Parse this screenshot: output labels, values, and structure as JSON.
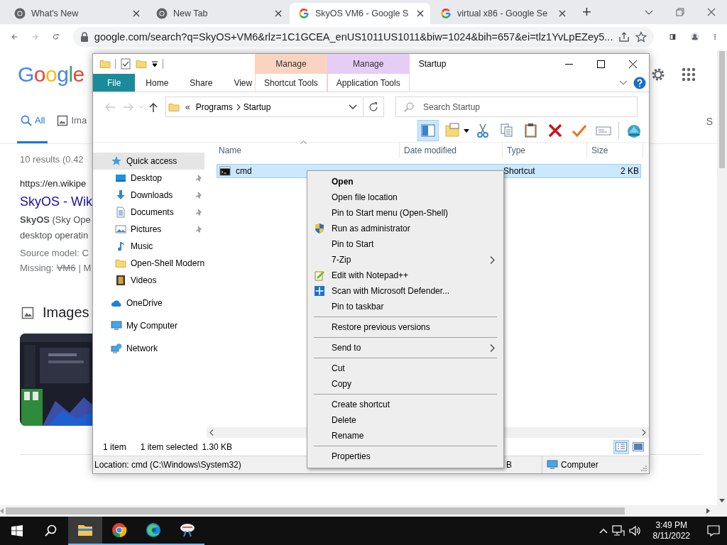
{
  "browser": {
    "tabs": [
      {
        "title": "What's New",
        "kind": "chrome",
        "selected": false
      },
      {
        "title": "New Tab",
        "kind": "chrome",
        "selected": false
      },
      {
        "title": "SkyOS VM6 - Google S",
        "kind": "google",
        "selected": true
      },
      {
        "title": "virtual x86 - Google Se",
        "kind": "google",
        "selected": false
      }
    ],
    "new_tab": "+",
    "url": "google.com/search?q=SkyOS+VM6&rlz=1C1GCEA_enUS1011US1011&biw=1024&bih=657&ei=tlz1YvLpEZey5..."
  },
  "google": {
    "logo": [
      {
        "letter": "G",
        "color": "#4285f4"
      },
      {
        "letter": "o",
        "color": "#ea4335"
      },
      {
        "letter": "o",
        "color": "#fbbc05"
      },
      {
        "letter": "g",
        "color": "#4285f4"
      },
      {
        "letter": "l",
        "color": "#34a853"
      },
      {
        "letter": "e",
        "color": "#ea4335"
      }
    ],
    "nav": [
      {
        "label": "All",
        "kind": "all",
        "selected": true
      },
      {
        "label": "Ima",
        "kind": "images",
        "selected": false
      }
    ],
    "nav_right": "S",
    "stats": "10 results (0.42",
    "result": {
      "url": "https://en.wikipe",
      "title": "SkyOS - Wik",
      "snippet": [
        "**SkyOS** (Sky Ope",
        "desktop operatin"
      ],
      "source": "Source model: C",
      "missing": {
        "label": "Missing:",
        "term": "VM6",
        "rest": "| M"
      }
    },
    "images_heading": "Images"
  },
  "explorer": {
    "title": "Startup",
    "tabs": [
      {
        "label": "File",
        "kind": "file"
      },
      {
        "label": "Home",
        "kind": "tab"
      },
      {
        "label": "Share",
        "kind": "tab"
      },
      {
        "label": "View",
        "kind": "tab"
      }
    ],
    "context_tabs": [
      {
        "heading": "Manage",
        "label": "Shortcut Tools",
        "color": "#fad4c0"
      },
      {
        "heading": "Manage",
        "label": "Application Tools",
        "color": "#e6cdf6"
      }
    ],
    "address": {
      "overflow": "«",
      "crumbs": [
        "Programs",
        "Startup"
      ]
    },
    "search": {
      "placeholder": "Search Startup"
    },
    "toolbar": [
      {
        "kind": "preview",
        "pressed": true
      },
      {
        "kind": "properties",
        "pressed": false
      },
      {
        "kind": "cut",
        "pressed": false
      },
      {
        "kind": "copy",
        "pressed": false
      },
      {
        "kind": "paste",
        "pressed": false
      },
      {
        "kind": "delete",
        "pressed": false
      },
      {
        "kind": "check",
        "pressed": false
      },
      {
        "kind": "rename",
        "pressed": false
      },
      {
        "kind": "shell",
        "pressed": false
      }
    ],
    "nav": [
      {
        "label": "Quick access",
        "kind": "star",
        "selected": true,
        "children": [
          {
            "label": "Desktop",
            "kind": "desktop",
            "pinned": true,
            "selected": false
          },
          {
            "label": "Downloads",
            "kind": "downloads",
            "pinned": true,
            "selected": false
          },
          {
            "label": "Documents",
            "kind": "documents",
            "pinned": true,
            "selected": false
          },
          {
            "label": "Pictures",
            "kind": "pictures",
            "pinned": true,
            "selected": false
          },
          {
            "label": "Music",
            "kind": "music",
            "pinned": false,
            "selected": false
          },
          {
            "label": "Open-Shell Modern",
            "kind": "folder",
            "pinned": false,
            "selected": false
          },
          {
            "label": "Videos",
            "kind": "videos",
            "pinned": false,
            "selected": false
          }
        ]
      },
      {
        "label": "OneDrive",
        "kind": "cloud",
        "selected": false
      },
      {
        "label": "My Computer",
        "kind": "computer",
        "selected": false
      },
      {
        "label": "Network",
        "kind": "network",
        "selected": false
      }
    ],
    "columns": [
      {
        "label": "Name",
        "sorted": true
      },
      {
        "label": "Date modified",
        "sorted": false
      },
      {
        "label": "Type",
        "sorted": false
      },
      {
        "label": "Size",
        "sorted": false
      }
    ],
    "files": [
      {
        "name": "cmd",
        "type": "Shortcut",
        "size": "2 KB",
        "selected": true
      }
    ],
    "status": {
      "count": "1 item",
      "selection": "1 item selected",
      "size": "1.30 KB"
    },
    "view_buttons": [
      {
        "kind": "details",
        "selected": true
      },
      {
        "kind": "tiles",
        "selected": false
      }
    ],
    "details_bar": {
      "location": "Location: cmd (C:\\Windows\\System32)",
      "size_tail": "B",
      "zone": "Computer"
    }
  },
  "context_menu": {
    "items": [
      {
        "kind": "item",
        "label": "Open",
        "default": true
      },
      {
        "kind": "item",
        "label": "Open file location",
        "default": false
      },
      {
        "kind": "item",
        "label": "Pin to Start menu (Open-Shell)",
        "default": false
      },
      {
        "kind": "admin",
        "label": "Run as administrator",
        "default": false
      },
      {
        "kind": "item",
        "label": "Pin to Start",
        "default": false
      },
      {
        "kind": "submenu",
        "label": "7-Zip",
        "default": false
      },
      {
        "kind": "notepad",
        "label": "Edit with Notepad++",
        "default": false
      },
      {
        "kind": "defender",
        "label": "Scan with Microsoft Defender...",
        "default": false
      },
      {
        "kind": "item",
        "label": "Pin to taskbar",
        "default": false
      },
      {
        "kind": "separator"
      },
      {
        "kind": "item",
        "label": "Restore previous versions",
        "default": false
      },
      {
        "kind": "separator"
      },
      {
        "kind": "submenu",
        "label": "Send to",
        "default": false
      },
      {
        "kind": "separator"
      },
      {
        "kind": "item",
        "label": "Cut",
        "default": false
      },
      {
        "kind": "item",
        "label": "Copy",
        "default": false
      },
      {
        "kind": "separator"
      },
      {
        "kind": "item",
        "label": "Create shortcut",
        "default": false
      },
      {
        "kind": "item",
        "label": "Delete",
        "default": false
      },
      {
        "kind": "item",
        "label": "Rename",
        "default": false
      },
      {
        "kind": "separator"
      },
      {
        "kind": "item",
        "label": "Properties",
        "default": false
      }
    ]
  },
  "taskbar": {
    "apps": [
      {
        "kind": "explorer",
        "selected": true
      },
      {
        "kind": "chrome",
        "selected": false
      },
      {
        "kind": "edge",
        "selected": false
      },
      {
        "kind": "snip",
        "selected": false
      }
    ],
    "time": "3:49 PM",
    "date": "8/11/2022"
  }
}
